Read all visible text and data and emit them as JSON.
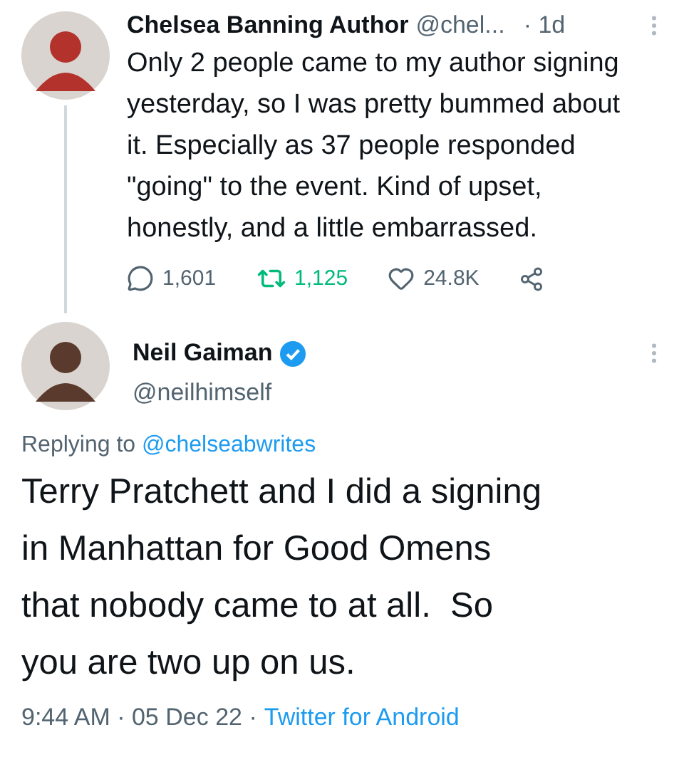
{
  "tweets": [
    {
      "kind": "original",
      "author": "Chelsea Banning Author",
      "handle": "@chel...",
      "time": "· 1d",
      "body_lines": [
        "Only 2 people came to my author signing",
        "yesterday, so I was pretty bummed about",
        "it. Especially as 37 people responded",
        "\"going\" to the event. Kind of upset,",
        "honestly, and a little embarrassed."
      ],
      "replies": "1,601",
      "retweets": "1,125",
      "retweeted": true,
      "likes": "24.8K",
      "liked": false
    },
    {
      "kind": "reply",
      "author": "Neil Gaiman",
      "verified": true,
      "handle": "@neilhimself",
      "replying_label": "Replying to",
      "replying_to": "@chelseabwrites",
      "body_lines": [
        "Terry Pratchett and I did a signing",
        "in Manhattan for Good Omens",
        "that nobody came to at all.  So",
        "you are two up on us."
      ],
      "meta": "9:44 AM · 05 Dec 22 ·",
      "source": "Twitter for Android"
    }
  ]
}
